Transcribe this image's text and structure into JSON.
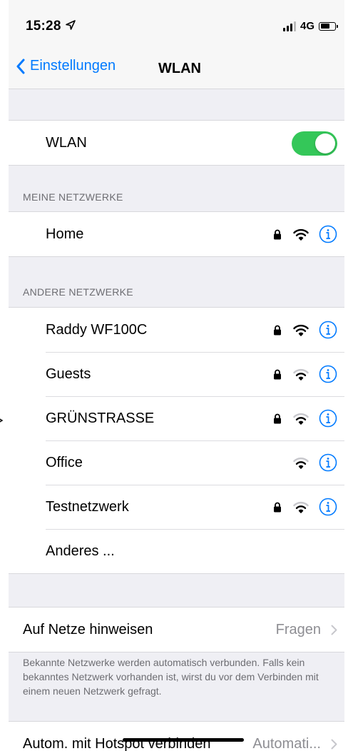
{
  "status": {
    "time": "15:28",
    "network": "4G",
    "location_icon": "location-arrow-icon",
    "signal_icon": "signal-bars-icon",
    "battery_icon": "battery-icon"
  },
  "nav": {
    "back_label": "Einstellungen",
    "title": "WLAN"
  },
  "wlan_toggle": {
    "label": "WLAN",
    "state": "on",
    "color": "#34c759"
  },
  "my_networks": {
    "header": "MEINE NETZWERKE",
    "items": [
      {
        "name": "Home",
        "locked": true,
        "signal": "full"
      }
    ]
  },
  "other_networks": {
    "header": "ANDERE NETZWERKE",
    "items": [
      {
        "name": "Raddy WF100C",
        "locked": true,
        "signal": "full"
      },
      {
        "name": "Guests",
        "locked": true,
        "signal": "medium"
      },
      {
        "name": "GRÜNSTRASSE",
        "locked": true,
        "signal": "medium"
      },
      {
        "name": "Office",
        "locked": false,
        "signal": "medium"
      },
      {
        "name": "Testnetzwerk",
        "locked": true,
        "signal": "medium"
      }
    ],
    "other_label": "Anderes ..."
  },
  "ask_join": {
    "label": "Auf Netze hinweisen",
    "value": "Fragen"
  },
  "footer_note": "Bekannte Netzwerke werden automatisch verbunden. Falls kein bekanntes Netzwerk vorhanden ist, wirst du vor dem Verbinden mit einem neuen Netzwerk gefragt.",
  "auto_hotspot": {
    "label": "Autom. mit Hotspot verbinden",
    "value": "Automati..."
  },
  "colors": {
    "accent": "#007aff",
    "toggle_on": "#34c759",
    "background": "#efeff4",
    "secondary_text": "#8e8e93"
  }
}
